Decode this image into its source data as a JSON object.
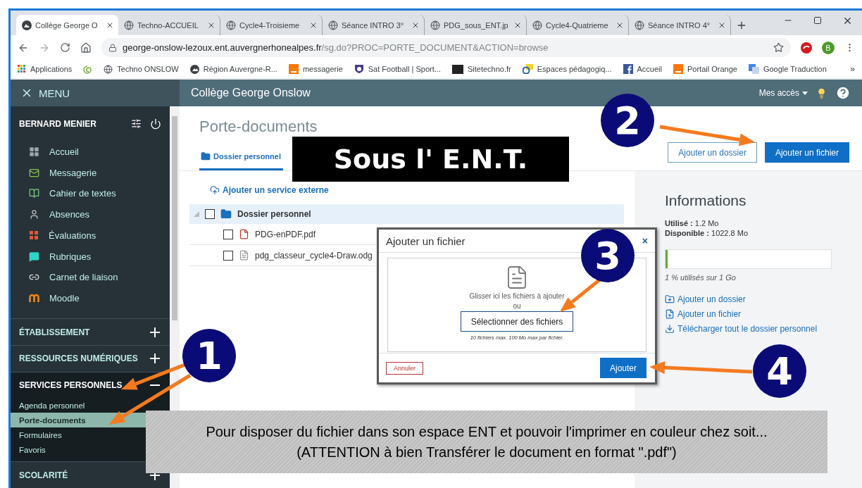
{
  "browser": {
    "tabs": [
      {
        "title": "Collège George O",
        "selected": true
      },
      {
        "title": "Techno-ACCUEIL",
        "selected": false
      },
      {
        "title": "Cycle4-Troisieme",
        "selected": false
      },
      {
        "title": "Séance INTRO 3°",
        "selected": false
      },
      {
        "title": "PDG_sous_ENT.jp",
        "selected": false
      },
      {
        "title": "Cycle4-Quatrieme",
        "selected": false
      },
      {
        "title": "Séance INTRO 4°",
        "selected": false
      }
    ],
    "url": {
      "host": "george-onslow-lezoux.ent.auvergnerhonealpes.fr",
      "path": "/sg.do?PROC=PORTE_DOCUMENT&ACTION=browse"
    },
    "profile_initial": "B",
    "bookmarks": [
      {
        "label": "Applications",
        "kind": "apps"
      },
      {
        "kind": "swirl"
      },
      {
        "label": "Techno  ONSLOW",
        "kind": "globe"
      },
      {
        "label": "Région Auvergne-R...",
        "kind": "region"
      },
      {
        "label": "messagerie",
        "kind": "orange"
      },
      {
        "label": "Sat Football | Sport...",
        "kind": "crest"
      },
      {
        "label": "Sitetechno.fr",
        "kind": "dark"
      },
      {
        "label": "Espaces pédagogiq...",
        "kind": "edu"
      },
      {
        "label": "Accueil",
        "kind": "facebook"
      },
      {
        "label": "Portail Orange",
        "kind": "orange"
      },
      {
        "label": "Google Traduction",
        "kind": "translate"
      }
    ],
    "more": "»"
  },
  "app": {
    "menu_label": "MENU",
    "title": "Collège George Onslow",
    "access_label": "Mes accès"
  },
  "sidebar": {
    "user": "BERNARD MENIER",
    "items": [
      {
        "label": "Accueil",
        "kind": "grid"
      },
      {
        "label": "Messagerie",
        "kind": "mail"
      },
      {
        "label": "Cahier de textes",
        "kind": "notebook"
      },
      {
        "label": "Absences",
        "kind": "absence"
      },
      {
        "label": "Évaluations",
        "kind": "grade"
      },
      {
        "label": "Rubriques",
        "kind": "chat"
      },
      {
        "label": "Carnet de liaison",
        "kind": "link"
      },
      {
        "label": "Moodle",
        "kind": "moodle"
      }
    ],
    "sections": [
      {
        "label": "ÉTABLISSEMENT",
        "expanded": false
      },
      {
        "label": "RESSOURCES NUMÉRIQUES",
        "expanded": false
      },
      {
        "label": "SERVICES PERSONNELS",
        "expanded": true,
        "children": [
          {
            "label": "Agenda personnel",
            "selected": false
          },
          {
            "label": "Porte-documents",
            "selected": true
          },
          {
            "label": "Formulaires",
            "selected": false
          },
          {
            "label": "Favoris",
            "selected": false
          }
        ]
      },
      {
        "label": "SCOLARITÉ",
        "expanded": false
      }
    ]
  },
  "page": {
    "title": "Porte-documents",
    "tab": "Dossier personnel",
    "buttons": [
      {
        "label": "Ajouter un dossier",
        "kind": "outline"
      },
      {
        "label": "Ajouter un fichier",
        "kind": "primary"
      }
    ],
    "add_service": "Ajouter un service externe",
    "tree": {
      "label": "Dossier personnel",
      "checked": false,
      "expanded": true,
      "children": [
        {
          "label": "PDG-enPDF.pdf",
          "kind": "pdf",
          "checked": false
        },
        {
          "label": "pdg_classeur_cycle4-Draw.odg",
          "kind": "doc",
          "checked": false
        }
      ]
    },
    "info": {
      "title": "Informations",
      "used_label": "Utilisé :",
      "used": "1.2 Mo",
      "free_label": "Disponible :",
      "free": "1022.8 Mo",
      "level": 0.01,
      "usage": "1 % utilisés sur 1 Go",
      "links": [
        {
          "label": "Ajouter un dossier",
          "kind": "folder-add"
        },
        {
          "label": "Ajouter un fichier",
          "kind": "file-add"
        },
        {
          "label": "Télécharger tout le dossier personnel",
          "kind": "download"
        }
      ]
    }
  },
  "dialog": {
    "title": "Ajouter un fichier",
    "close": "×",
    "drop_text": "Glisser ici les fichiers à ajouter",
    "or": "ou",
    "select": "Sélectionner des fichiers",
    "hint": "10 fichiers max. 100 Mo max par fichier.",
    "cancel": "Annuler",
    "submit": "Ajouter"
  },
  "annotations": {
    "label": "Sous l' E.N.T.",
    "markers": [
      "1",
      "2",
      "3",
      "4"
    ],
    "caption": [
      "Pour disposer du fichier dans son espace ENT et pouvoir l'imprimer en couleur chez soit...",
      "(ATTENTION à bien Transférer le document en format \".pdf\")"
    ]
  }
}
